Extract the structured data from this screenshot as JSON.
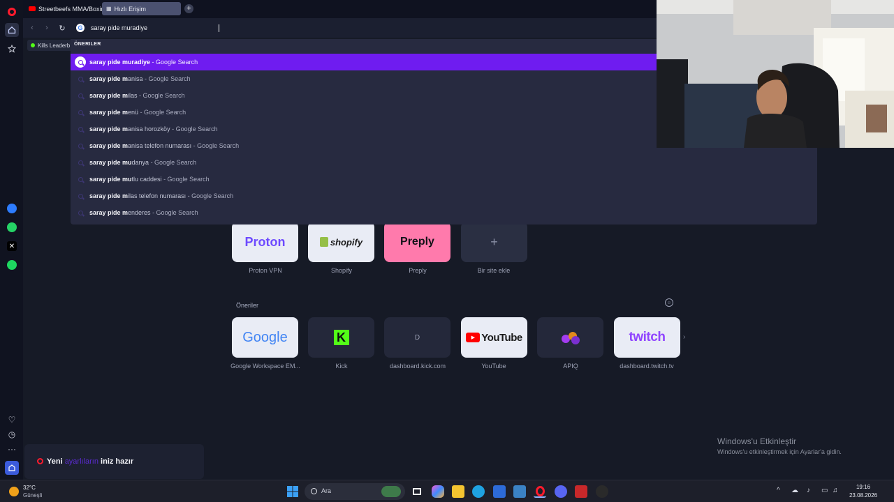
{
  "tabs": [
    {
      "label": "Streetbeefs MMA/Boxing",
      "active": false
    },
    {
      "label": "Hızlı Erişim",
      "active": true
    }
  ],
  "toolbar": {
    "address_value": "saray pide muradiye"
  },
  "bookmarks": [
    {
      "label": "Kills Leaderb"
    }
  ],
  "dropdown": {
    "header": "ÖNERILER",
    "items": [
      {
        "bold": "saray pide muradiye",
        "rest": "",
        "suffix": " - Google Search"
      },
      {
        "bold": "saray pide m",
        "rest": "anisa",
        "suffix": " - Google Search"
      },
      {
        "bold": "saray pide m",
        "rest": "ilas",
        "suffix": " - Google Search"
      },
      {
        "bold": "saray pide m",
        "rest": "enü",
        "suffix": " - Google Search"
      },
      {
        "bold": "saray pide m",
        "rest": "anisa horozköy",
        "suffix": " - Google Search"
      },
      {
        "bold": "saray pide m",
        "rest": "anisa telefon numarası",
        "suffix": " - Google Search"
      },
      {
        "bold": "saray pide mu",
        "rest": "danya",
        "suffix": " - Google Search"
      },
      {
        "bold": "saray pide mu",
        "rest": "tlu caddesi",
        "suffix": " - Google Search"
      },
      {
        "bold": "saray pide m",
        "rest": "ilas telefon numarası",
        "suffix": " - Google Search"
      },
      {
        "bold": "saray pide m",
        "rest": "enderes",
        "suffix": " - Google Search"
      }
    ]
  },
  "speed_dial": {
    "top": [
      {
        "logo": "Proton",
        "label": "Proton VPN",
        "color": "#6d4aff"
      },
      {
        "logo": "shopify",
        "label": "Shopify",
        "color": "#95bf47"
      },
      {
        "logo": "Preply",
        "label": "Preply",
        "color": "#ff7aac"
      },
      {
        "logo": "+",
        "label": "Bir site ekle",
        "color": "#2a2f42"
      }
    ],
    "suggestions_title": "Öneriler",
    "suggestions": [
      {
        "logo": "Google",
        "label": "Google Workspace EM..."
      },
      {
        "logo": "K",
        "label": "Kick"
      },
      {
        "logo": "D",
        "label": "dashboard.kick.com"
      },
      {
        "logo": "YouTube",
        "label": "YouTube"
      },
      {
        "logo": "",
        "label": "APIQ"
      },
      {
        "logo": "twitch",
        "label": "dashboard.twitch.tv"
      }
    ]
  },
  "watermark": {
    "title": "Windows'u Etkinleştir",
    "subtitle": "Windows'u etkinleştirmek için Ayarlar'a gidin."
  },
  "toast": {
    "prefix": "Yeni ",
    "highlight": "ayarlıların",
    "suffix": " iniz hazır"
  },
  "taskbar": {
    "temp": "32°C",
    "condition": "Güneşli",
    "search_placeholder": "Ara",
    "time": "19:16",
    "date": "23.08.2026"
  },
  "colors": {
    "accent": "#6f1cf0",
    "opera_red": "#ff1b2d"
  }
}
